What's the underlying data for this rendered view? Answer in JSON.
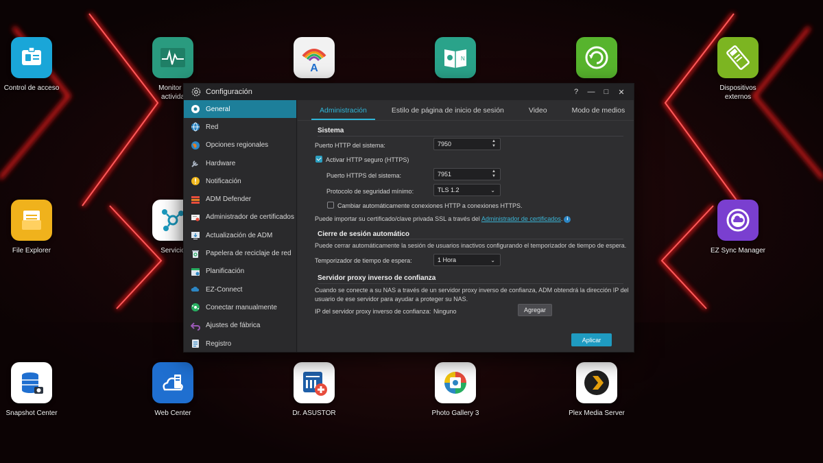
{
  "desktop": {
    "apps_top": [
      {
        "label": "Control de acceso",
        "label2": "",
        "color": "#1aa6d8"
      },
      {
        "label": "Monitor d",
        "label2": "activida",
        "color": "#2a9b7f"
      },
      {
        "label": "",
        "label2": "",
        "color": "#f2f2f2"
      },
      {
        "label": "",
        "label2": "",
        "color": "#2aa38a"
      },
      {
        "label": "",
        "label2": "",
        "color": "#57b42d"
      },
      {
        "label": "Dispositivos",
        "label2": "externos",
        "color": "#7cb521"
      }
    ],
    "apps_mid": [
      {
        "label": "File Explorer",
        "color": "#f0b21c"
      },
      {
        "label": "Servicio",
        "color": "#1b9bc0"
      },
      {
        "label": "EZ Sync Manager",
        "color": "#7a3fd0"
      }
    ],
    "apps_bottom": [
      {
        "label": "Snapshot Center",
        "color": "#ffffff"
      },
      {
        "label": "Web Center",
        "color": "#1f6fd0"
      },
      {
        "label": "Dr. ASUSTOR",
        "color": "#ffffff"
      },
      {
        "label": "Photo Gallery 3",
        "color": "#ffffff"
      },
      {
        "label": "Plex Media Server",
        "color": "#ffffff"
      }
    ]
  },
  "window": {
    "title": "Configuración",
    "controls": {
      "help": "?",
      "minimize": "—",
      "maximize": "□",
      "close": "✕"
    }
  },
  "sidebar": {
    "items": [
      {
        "label": "General",
        "icon": "general-icon"
      },
      {
        "label": "Red",
        "icon": "globe-icon"
      },
      {
        "label": "Opciones regionales",
        "icon": "region-icon"
      },
      {
        "label": "Hardware",
        "icon": "hardware-icon"
      },
      {
        "label": "Notificación",
        "icon": "notification-icon"
      },
      {
        "label": "ADM Defender",
        "icon": "defender-icon"
      },
      {
        "label": "Administrador de certificados",
        "icon": "certificate-icon"
      },
      {
        "label": "Actualización de ADM",
        "icon": "update-icon"
      },
      {
        "label": "Papelera de reciclaje de red",
        "icon": "recycle-bin-icon"
      },
      {
        "label": "Planificación",
        "icon": "calendar-icon"
      },
      {
        "label": "EZ-Connect",
        "icon": "cloud-icon"
      },
      {
        "label": "Conectar manualmente",
        "icon": "connect-icon"
      },
      {
        "label": "Ajustes de fábrica",
        "icon": "reset-icon"
      },
      {
        "label": "Registro",
        "icon": "log-icon"
      }
    ]
  },
  "tabs": [
    "Administración",
    "Estilo de página de inicio de sesión",
    "Video",
    "Modo de medios"
  ],
  "system": {
    "title": "Sistema",
    "http_port_label": "Puerto HTTP del sistema:",
    "http_port_value": "7950",
    "https_enable_label": "Activar HTTP seguro (HTTPS)",
    "https_port_label": "Puerto HTTPS del sistema:",
    "https_port_value": "7951",
    "protocol_label": "Protocolo de seguridad mínimo:",
    "protocol_value": "TLS 1.2",
    "redirect_label": "Cambiar automáticamente conexiones HTTP a conexiones HTTPS.",
    "import_text": "Puede importar su certificado/clave privada SSL a través del",
    "import_link": "Administrador de certificados",
    "import_suffix": "."
  },
  "logout": {
    "title": "Cierre de sesión automático",
    "description": "Puede cerrar automáticamente la sesión de usuarios inactivos configurando el temporizador de tiempo de espera.",
    "timer_label": "Temporizador de tiempo de espera:",
    "timer_value": "1 Hora"
  },
  "proxy": {
    "title": "Servidor proxy inverso de confianza",
    "description_line1": "Cuando se conecte a su NAS a través de un servidor proxy inverso de confianza, ADM obtendrá la dirección IP del",
    "description_line2": "usuario de ese servidor para ayudar a proteger su NAS.",
    "ip_label": "IP del servidor proxy inverso de confianza:",
    "ip_value": "Ninguno",
    "add_button": "Agregar"
  },
  "apply_button": "Aplicar"
}
